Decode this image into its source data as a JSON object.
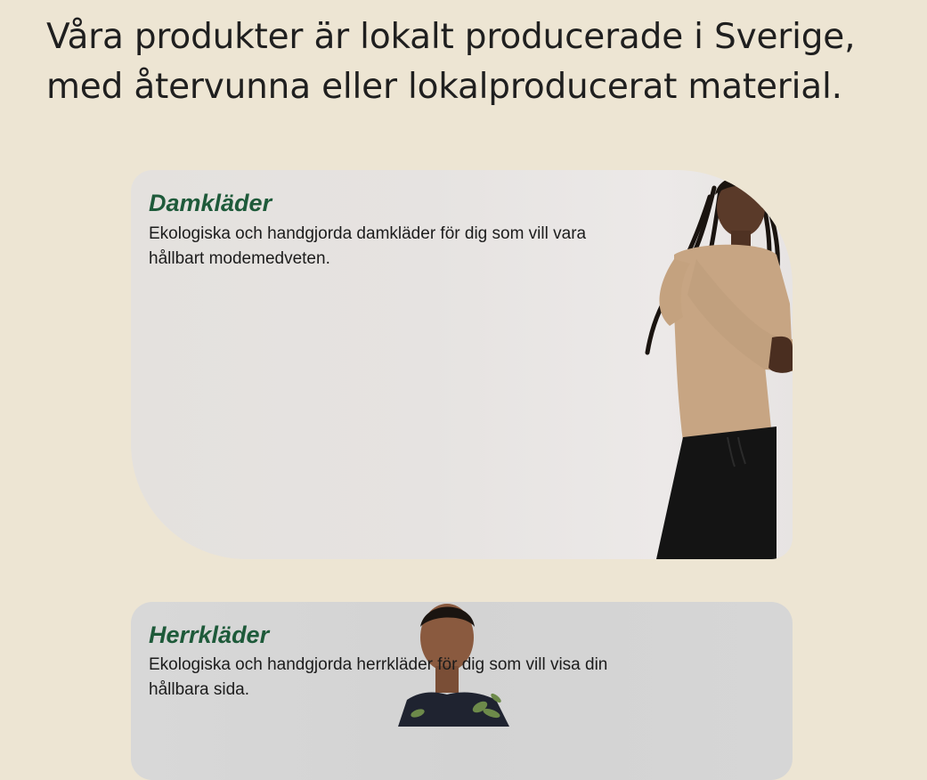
{
  "intro": {
    "text": "Våra produkter är lokalt producerade i Sverige, med återvunna eller lokalproducerat material."
  },
  "categories": [
    {
      "title": "Damkläder",
      "description": "Ekologiska och handgjorda damkläder för dig som vill vara hållbart modemedveten.",
      "image": "woman-in-beige-sweater-photo"
    },
    {
      "title": "Herrkläder",
      "description": "Ekologiska och handgjorda herrkläder för dig som vill visa din hållbara sida.",
      "image": "man-in-floral-shirt-photo"
    }
  ],
  "colors": {
    "page_background": "#ede5d3",
    "title_green": "#1e5a3a",
    "text": "#1c1c1c"
  }
}
